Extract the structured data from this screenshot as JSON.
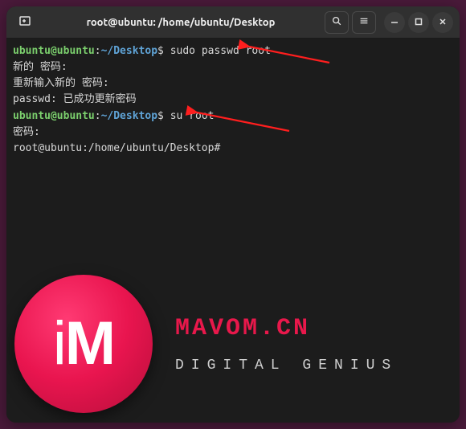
{
  "window": {
    "title": "root@ubuntu: /home/ubuntu/Desktop"
  },
  "terminal": {
    "prompt_user": "ubuntu@ubuntu",
    "prompt_sep": ":",
    "prompt_path": "~/Desktop",
    "prompt_sym": "$ ",
    "lines": {
      "cmd1": "sudo passwd root",
      "out1": "新的 密码:",
      "out2": "重新输入新的 密码:",
      "out3": "passwd: 已成功更新密码",
      "cmd2": "su root",
      "out4": "密码:",
      "root_prompt": "root@ubuntu:/home/ubuntu/Desktop# "
    }
  },
  "watermark": {
    "logo_text": "iM",
    "title": "MAVOM.CN",
    "subtitle": "DIGITAL GENIUS"
  },
  "icons": {
    "new_tab": "new-tab-icon",
    "search": "search-icon",
    "menu": "menu-icon",
    "minimize": "minimize-icon",
    "maximize": "maximize-icon",
    "close": "close-icon"
  }
}
